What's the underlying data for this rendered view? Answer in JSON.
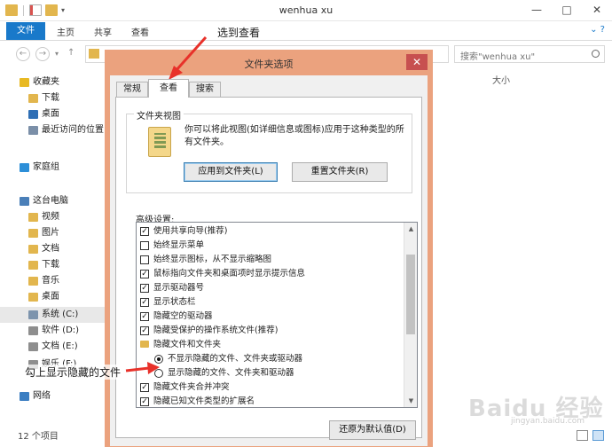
{
  "window": {
    "title": "wenhua xu",
    "minimize": "—",
    "maximize": "□",
    "close": "✕"
  },
  "ribbon": {
    "tabs": [
      "文件",
      "主页",
      "共享",
      "查看"
    ],
    "expand": "⌄ ?"
  },
  "address": {
    "back": "←",
    "forward": "→",
    "search_placeholder": "搜索\"wenhua xu\""
  },
  "nav_pane": {
    "items": [
      {
        "label": "收藏夹",
        "icon": "star-icon",
        "color": "#e8b923",
        "indent": 0,
        "selected": false
      },
      {
        "label": "下载",
        "icon": "download-folder-icon",
        "color": "#e2b64e",
        "indent": 1,
        "selected": false
      },
      {
        "label": "桌面",
        "icon": "desktop-icon",
        "color": "#2f6fb5",
        "indent": 1,
        "selected": false
      },
      {
        "label": "最近访问的位置",
        "icon": "recent-places-icon",
        "color": "#7b8fa8",
        "indent": 1,
        "selected": false
      },
      {
        "label": "家庭组",
        "icon": "homegroup-icon",
        "color": "#2d8fd8",
        "indent": 0,
        "selected": false
      },
      {
        "label": "这台电脑",
        "icon": "computer-icon",
        "color": "#4a7fb8",
        "indent": 0,
        "selected": false
      },
      {
        "label": "视频",
        "icon": "videos-folder-icon",
        "color": "#e2b64e",
        "indent": 1,
        "selected": false
      },
      {
        "label": "图片",
        "icon": "pictures-folder-icon",
        "color": "#e2b64e",
        "indent": 1,
        "selected": false
      },
      {
        "label": "文档",
        "icon": "documents-folder-icon",
        "color": "#e2b64e",
        "indent": 1,
        "selected": false
      },
      {
        "label": "下载",
        "icon": "download-folder-icon",
        "color": "#e2b64e",
        "indent": 1,
        "selected": false
      },
      {
        "label": "音乐",
        "icon": "music-folder-icon",
        "color": "#e2b64e",
        "indent": 1,
        "selected": false
      },
      {
        "label": "桌面",
        "icon": "desktop-folder-icon",
        "color": "#e2b64e",
        "indent": 1,
        "selected": false
      },
      {
        "label": "系统 (C:)",
        "icon": "drive-c-icon",
        "color": "#7d94ad",
        "indent": 1,
        "selected": true
      },
      {
        "label": "软件 (D:)",
        "icon": "drive-icon",
        "color": "#8e8e8e",
        "indent": 1,
        "selected": false
      },
      {
        "label": "文档 (E:)",
        "icon": "drive-icon",
        "color": "#8e8e8e",
        "indent": 1,
        "selected": false
      },
      {
        "label": "娱乐 (F:)",
        "icon": "drive-icon",
        "color": "#8e8e8e",
        "indent": 1,
        "selected": false
      },
      {
        "label": "网络",
        "icon": "network-icon",
        "color": "#3b7ec2",
        "indent": 0,
        "selected": false
      }
    ]
  },
  "content": {
    "column_size": "大小"
  },
  "status": {
    "item_count": "12 个项目"
  },
  "dialog": {
    "title": "文件夹选项",
    "close": "✕",
    "tabs": [
      "常规",
      "查看",
      "搜索"
    ],
    "active_tab": "查看",
    "folder_views": {
      "group_label": "文件夹视图",
      "description": "你可以将此视图(如详细信息或图标)应用于这种类型的所有文件夹。",
      "apply_button": "应用到文件夹(L)",
      "reset_button": "重置文件夹(R)"
    },
    "advanced_label": "高级设置:",
    "advanced_items": [
      {
        "type": "checkbox",
        "checked": true,
        "label": "使用共享向导(推荐)"
      },
      {
        "type": "checkbox",
        "checked": false,
        "label": "始终显示菜单"
      },
      {
        "type": "checkbox",
        "checked": false,
        "label": "始终显示图标，从不显示缩略图"
      },
      {
        "type": "checkbox",
        "checked": true,
        "label": "鼠标指向文件夹和桌面项时显示提示信息"
      },
      {
        "type": "checkbox",
        "checked": true,
        "label": "显示驱动器号"
      },
      {
        "type": "checkbox",
        "checked": true,
        "label": "显示状态栏"
      },
      {
        "type": "checkbox",
        "checked": true,
        "label": "隐藏空的驱动器"
      },
      {
        "type": "checkbox",
        "checked": true,
        "label": "隐藏受保护的操作系统文件(推荐)"
      },
      {
        "type": "folder",
        "checked": false,
        "label": "隐藏文件和文件夹"
      },
      {
        "type": "radio",
        "checked": true,
        "label": "不显示隐藏的文件、文件夹或驱动器"
      },
      {
        "type": "radio",
        "checked": false,
        "label": "显示隐藏的文件、文件夹和驱动器"
      },
      {
        "type": "checkbox",
        "checked": true,
        "label": "隐藏文件夹合并冲突"
      },
      {
        "type": "checkbox",
        "checked": true,
        "label": "隐藏已知文件类型的扩展名"
      }
    ],
    "restore_button": "还原为默认值(D)"
  },
  "annotations": {
    "select_view": "选到查看",
    "check_show_hidden": "勾上显示隐藏的文件"
  },
  "watermark": {
    "brand": "Baidu 经验",
    "sub": "jingyan.baidu.com"
  },
  "colors": {
    "accent": "#1979ca",
    "dialog_border": "#eba27e",
    "close_red": "#c75050",
    "arrow_red": "#e8312a"
  }
}
